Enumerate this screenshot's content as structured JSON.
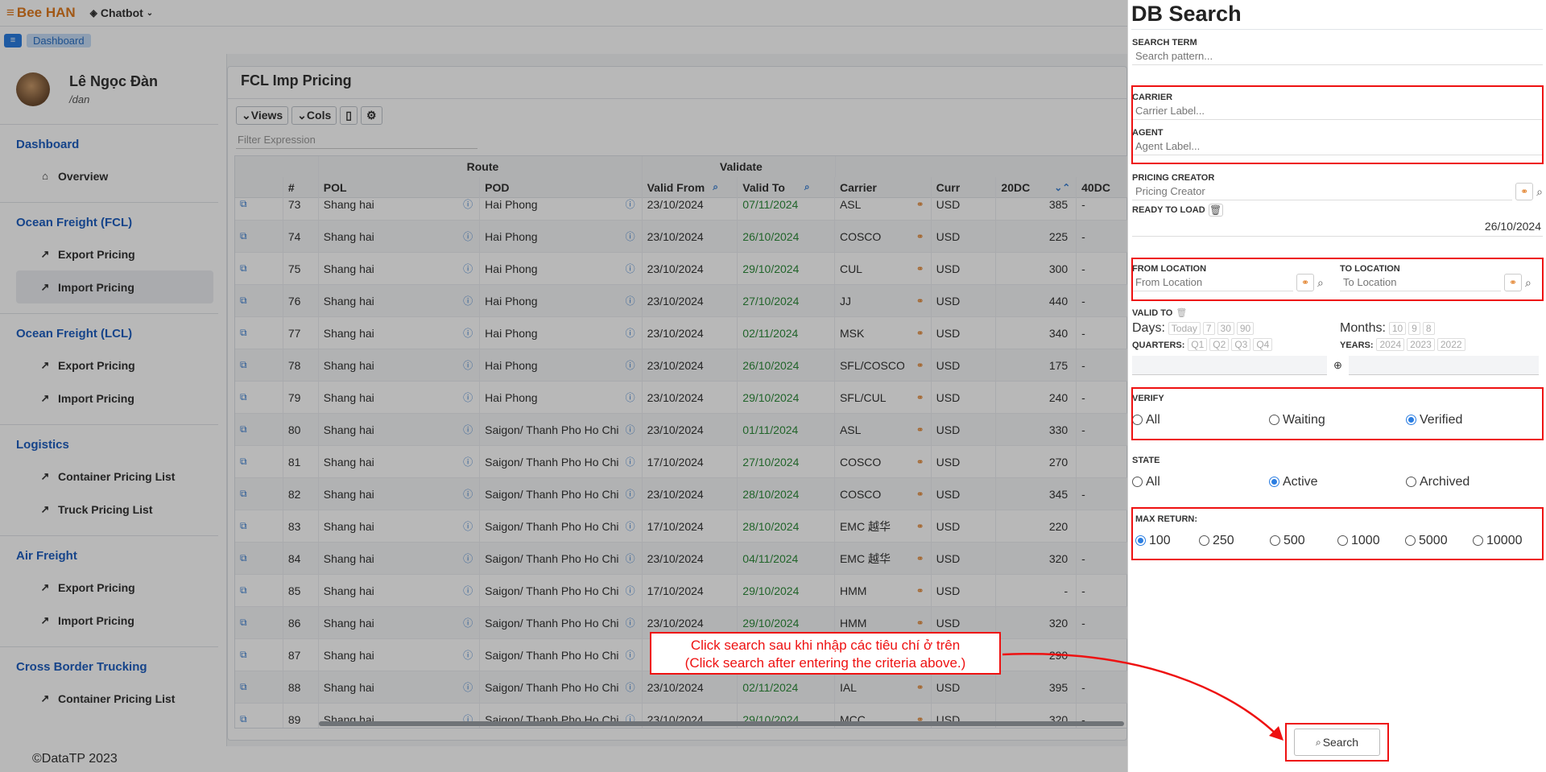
{
  "topbar": {
    "brand": "Bee HAN",
    "chatbot": "Chatbot"
  },
  "breadcrumb": {
    "dashboard": "Dashboard"
  },
  "user": {
    "name": "Lê Ngọc Đàn",
    "handle": "/dan"
  },
  "sidebar": {
    "sections": [
      {
        "title": "Dashboard",
        "items": [
          "Overview"
        ]
      },
      {
        "title": "Ocean Freight (FCL)",
        "items": [
          "Export Pricing",
          "Import Pricing"
        ]
      },
      {
        "title": "Ocean Freight (LCL)",
        "items": [
          "Export Pricing",
          "Import Pricing"
        ]
      },
      {
        "title": "Logistics",
        "items": [
          "Container Pricing List",
          "Truck Pricing List"
        ]
      },
      {
        "title": "Air Freight",
        "items": [
          "Export Pricing",
          "Import Pricing"
        ]
      },
      {
        "title": "Cross Border Trucking",
        "items": [
          "Container Pricing List"
        ]
      }
    ]
  },
  "footer": "©DataTP 2023",
  "main": {
    "title": "FCL Imp Pricing",
    "toolbar": {
      "views": "Views",
      "cols": "Cols"
    },
    "filter_placeholder": "Filter Expression",
    "groups": {
      "route": "Route",
      "validate": "Validate"
    },
    "columns": [
      "#",
      "POL",
      "POD",
      "Valid From",
      "Valid To",
      "Carrier",
      "Curr",
      "20DC",
      "40DC"
    ],
    "rows": [
      [
        "73",
        "Shang hai",
        "Hai Phong",
        "23/10/2024",
        "07/11/2024",
        "ASL",
        "USD",
        "385",
        "-"
      ],
      [
        "74",
        "Shang hai",
        "Hai Phong",
        "23/10/2024",
        "26/10/2024",
        "COSCO",
        "USD",
        "225",
        "-"
      ],
      [
        "75",
        "Shang hai",
        "Hai Phong",
        "23/10/2024",
        "29/10/2024",
        "CUL",
        "USD",
        "300",
        "-"
      ],
      [
        "76",
        "Shang hai",
        "Hai Phong",
        "23/10/2024",
        "27/10/2024",
        "JJ",
        "USD",
        "440",
        "-"
      ],
      [
        "77",
        "Shang hai",
        "Hai Phong",
        "23/10/2024",
        "02/11/2024",
        "MSK",
        "USD",
        "340",
        "-"
      ],
      [
        "78",
        "Shang hai",
        "Hai Phong",
        "23/10/2024",
        "26/10/2024",
        "SFL/COSCO",
        "USD",
        "175",
        "-"
      ],
      [
        "79",
        "Shang hai",
        "Hai Phong",
        "23/10/2024",
        "29/10/2024",
        "SFL/CUL",
        "USD",
        "240",
        "-"
      ],
      [
        "80",
        "Shang hai",
        "Saigon/ Thanh Pho Ho Chi",
        "23/10/2024",
        "01/11/2024",
        "ASL",
        "USD",
        "330",
        "-"
      ],
      [
        "81",
        "Shang hai",
        "Saigon/ Thanh Pho Ho Chi",
        "17/10/2024",
        "27/10/2024",
        "COSCO",
        "USD",
        "270",
        ""
      ],
      [
        "82",
        "Shang hai",
        "Saigon/ Thanh Pho Ho Chi",
        "23/10/2024",
        "28/10/2024",
        "COSCO",
        "USD",
        "345",
        "-"
      ],
      [
        "83",
        "Shang hai",
        "Saigon/ Thanh Pho Ho Chi",
        "17/10/2024",
        "28/10/2024",
        "EMC 越华",
        "USD",
        "220",
        ""
      ],
      [
        "84",
        "Shang hai",
        "Saigon/ Thanh Pho Ho Chi",
        "23/10/2024",
        "04/11/2024",
        "EMC 越华",
        "USD",
        "320",
        "-"
      ],
      [
        "85",
        "Shang hai",
        "Saigon/ Thanh Pho Ho Chi",
        "17/10/2024",
        "29/10/2024",
        "HMM",
        "USD",
        "-",
        "-"
      ],
      [
        "86",
        "Shang hai",
        "Saigon/ Thanh Pho Ho Chi",
        "23/10/2024",
        "29/10/2024",
        "HMM",
        "USD",
        "320",
        "-"
      ],
      [
        "87",
        "Shang hai",
        "Saigon/ Thanh Pho Ho Chi",
        "",
        "",
        "",
        "",
        "290",
        ""
      ],
      [
        "88",
        "Shang hai",
        "Saigon/ Thanh Pho Ho Chi",
        "23/10/2024",
        "02/11/2024",
        "IAL",
        "USD",
        "395",
        "-"
      ],
      [
        "89",
        "Shang hai",
        "Saigon/ Thanh Pho Ho Chi",
        "23/10/2024",
        "29/10/2024",
        "MCC",
        "USD",
        "320",
        "-"
      ]
    ]
  },
  "drawer": {
    "title": "DB Search",
    "search_term": {
      "label": "SEARCH TERM",
      "placeholder": "Search pattern..."
    },
    "carrier": {
      "label": "CARRIER",
      "placeholder": "Carrier Label..."
    },
    "agent": {
      "label": "AGENT",
      "placeholder": "Agent Label..."
    },
    "pricing_creator": {
      "label": "PRICING CREATOR",
      "placeholder": "Pricing Creator"
    },
    "ready_to_load": {
      "label": "READY TO LOAD",
      "value": "26/10/2024"
    },
    "from_location": {
      "label": "FROM LOCATION",
      "placeholder": "From Location"
    },
    "to_location": {
      "label": "TO LOCATION",
      "placeholder": "To Location"
    },
    "valid_to": {
      "label": "VALID TO"
    },
    "days": {
      "label": "Days:",
      "chips": [
        "Today",
        "7",
        "30",
        "90"
      ]
    },
    "months": {
      "label": "Months:",
      "chips": [
        "10",
        "9",
        "8"
      ]
    },
    "quarters": {
      "label": "QUARTERS:",
      "chips": [
        "Q1",
        "Q2",
        "Q3",
        "Q4"
      ]
    },
    "years": {
      "label": "YEARS:",
      "chips": [
        "2024",
        "2023",
        "2022"
      ]
    },
    "verify": {
      "label": "VERIFY",
      "options": [
        "All",
        "Waiting",
        "Verified"
      ],
      "selected": "Verified"
    },
    "state": {
      "label": "STATE",
      "options": [
        "All",
        "Active",
        "Archived"
      ],
      "selected": "Active"
    },
    "max_return": {
      "label": "MAX RETURN:",
      "options": [
        "100",
        "250",
        "500",
        "1000",
        "5000",
        "10000"
      ],
      "selected": "100"
    },
    "search_button": "Search"
  },
  "annotation": {
    "line1": "Click search sau khi nhập các tiêu chí ở trên",
    "line2": "(Click search after entering the criteria above.)"
  },
  "colors": {
    "accent": "#2a7de1",
    "brand": "#e07a1f",
    "annotation": "#e11111",
    "valid_to": "#2e8b3b"
  }
}
